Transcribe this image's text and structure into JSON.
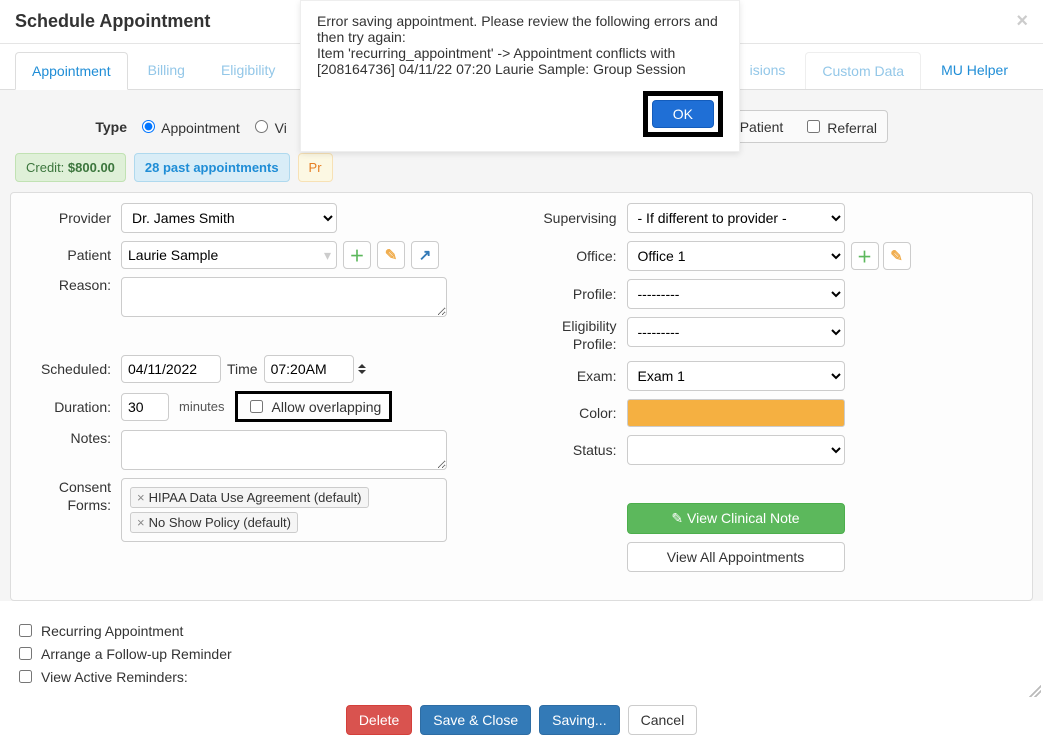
{
  "header": {
    "title": "Schedule Appointment"
  },
  "tabs": {
    "appointment": "Appointment",
    "billing": "Billing",
    "eligibility": "Eligibility",
    "isions": "isions",
    "custom": "Custom Data",
    "mu": "MU Helper"
  },
  "alert": {
    "line1": "Error saving appointment. Please review the following errors and then try again:",
    "line2": "Item 'recurring_appointment' -> Appointment conflicts with [208164736] 04/11/22 07:20 Laurie Sample: Group Session",
    "ok": "OK"
  },
  "type": {
    "label": "Type",
    "appointment": "Appointment",
    "vi": "Vi",
    "patient": "Patient",
    "referral": "Referral"
  },
  "pills": {
    "credit_label": "Credit: ",
    "credit_value": "$800.00",
    "past": "28 past appointments",
    "pr": "Pr"
  },
  "left": {
    "provider_label": "Provider",
    "provider_value": "Dr. James Smith",
    "patient_label": "Patient",
    "patient_value": "Laurie Sample",
    "reason_label": "Reason:",
    "scheduled_label": "Scheduled:",
    "scheduled_date": "04/11/2022",
    "time_label": "Time",
    "scheduled_time": "07:20AM",
    "duration_label": "Duration:",
    "duration_value": "30",
    "minutes_label": "minutes",
    "allow_overlap": "Allow overlapping",
    "notes_label": "Notes:",
    "consent_label_1": "Consent",
    "consent_label_2": "Forms:",
    "tag1": "HIPAA Data Use Agreement (default)",
    "tag2": "No Show Policy (default)"
  },
  "right": {
    "supervising_label": "Supervising",
    "supervising_value": "- If different to provider -",
    "office_label": "Office:",
    "office_value": "Office 1",
    "profile_label": "Profile:",
    "profile_value": "---------",
    "eligibility_label_1": "Eligibility",
    "eligibility_label_2": "Profile:",
    "eligibility_value": "---------",
    "exam_label": "Exam:",
    "exam_value": "Exam 1",
    "color_label": "Color:",
    "status_label": "Status:",
    "view_clinical": "View Clinical Note",
    "view_all": "View All Appointments"
  },
  "bottom": {
    "recurring": "Recurring Appointment",
    "followup": "Arrange a Follow-up Reminder",
    "active": "View Active Reminders:"
  },
  "footer": {
    "delete": "Delete",
    "saveclose": "Save & Close",
    "saving": "Saving...",
    "cancel": "Cancel"
  }
}
